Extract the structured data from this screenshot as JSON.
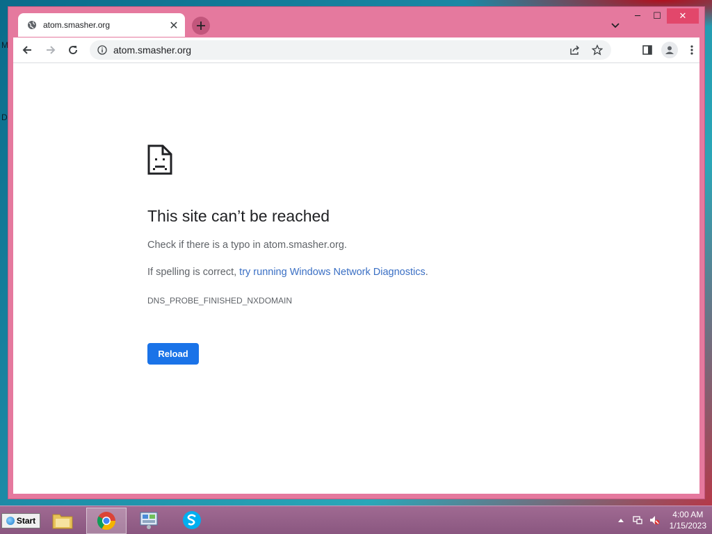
{
  "desktop": {
    "edge_labels": [
      "M",
      "D"
    ]
  },
  "tab": {
    "title": "atom.smasher.org",
    "close_glyph": "✕"
  },
  "window_controls": {
    "minimize": "─",
    "maximize": "☐",
    "close": "✕"
  },
  "toolbar": {
    "url": "atom.smasher.org"
  },
  "error_page": {
    "title": "This site can’t be reached",
    "line1": "Check if there is a typo in atom.smasher.org.",
    "line2_prefix": "If spelling is correct, ",
    "line2_link": "try running Windows Network Diagnostics",
    "line2_suffix": ".",
    "error_code": "DNS_PROBE_FINISHED_NXDOMAIN",
    "reload_label": "Reload"
  },
  "taskbar": {
    "start_label": "Start",
    "apps": [
      "file-explorer",
      "chrome",
      "control-panel",
      "skype"
    ],
    "clock_time": "4:00 AM",
    "clock_date": "1/15/2023"
  },
  "colors": {
    "window_frame": "#e5799e",
    "accent_blue": "#1a73e8",
    "link_blue": "#3a6fc4"
  }
}
